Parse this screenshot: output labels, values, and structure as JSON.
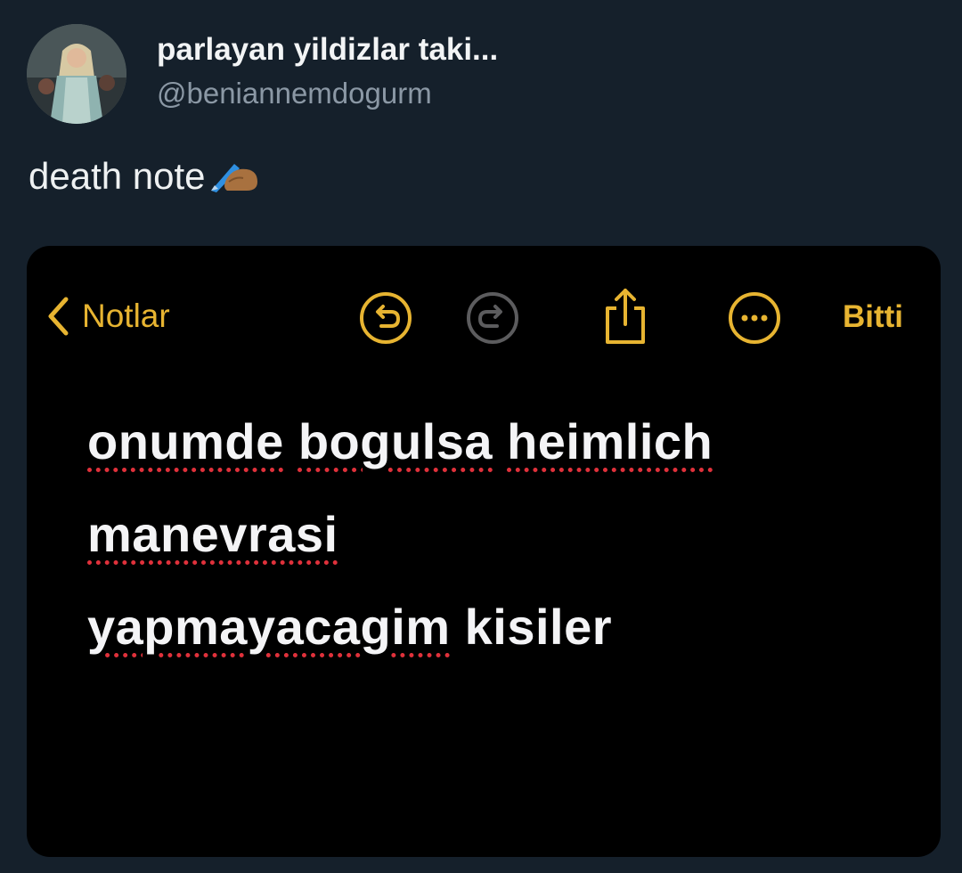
{
  "tweet": {
    "display_name": "parlayan yildizlar taki...",
    "handle": "@beniannemdogurm",
    "text": "death note",
    "emoji_icon": "writing-hand-icon"
  },
  "notes_app": {
    "back_label": "Notlar",
    "done_label": "Bitti",
    "accent_color": "#e7b431",
    "toolbar_icons": [
      "undo-icon",
      "redo-icon",
      "share-icon",
      "more-icon"
    ],
    "note_lines": [
      [
        "onumde",
        " ",
        "bogulsa",
        " ",
        "heimlich"
      ],
      [
        "manevrasi"
      ],
      [
        "yapmayacagim",
        " ",
        "kisiler"
      ]
    ],
    "misspelled_words": [
      "onumde",
      "bogulsa",
      "heimlich",
      "manevrasi",
      "yapmayacagim"
    ]
  }
}
